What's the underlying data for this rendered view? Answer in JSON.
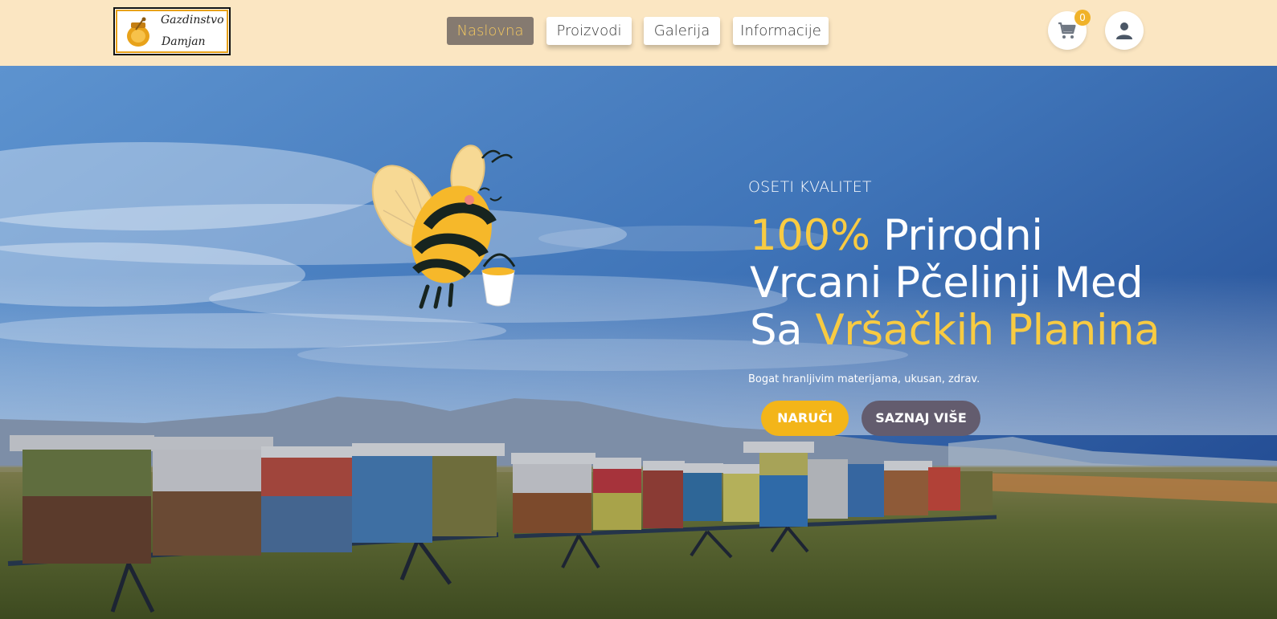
{
  "logo": {
    "line1": "Gazdinstvo",
    "line2": "Damjan",
    "icon": "honey-pot-icon"
  },
  "nav": {
    "items": [
      {
        "label": "Naslovna",
        "active": true
      },
      {
        "label": "Proizvodi",
        "active": false
      },
      {
        "label": "Galerija",
        "active": false
      },
      {
        "label": "Informacije",
        "active": false
      }
    ]
  },
  "header_actions": {
    "cart_icon": "shopping-cart-icon",
    "cart_count": "0",
    "user_icon": "user-icon"
  },
  "hero": {
    "eyebrow": "OSETI KVALITET",
    "headline": {
      "line1_highlight": "100%",
      "line1_rest": " Prirodni",
      "line2": "Vrcani Pčelinji Med",
      "line3_prefix": "Sa ",
      "line3_highlight": "Vršačkih Planina"
    },
    "tagline": "Bogat hranljivim materijama, ukusan, zdrav.",
    "order_button": "NARUČI",
    "more_button": "SAZNAJ VIŠE"
  },
  "colors": {
    "header_bg": "#fbe6c2",
    "accent_yellow": "#f8cb42",
    "order_button": "#f3b519",
    "more_button": "#635c6e",
    "active_nav": "#857a70"
  }
}
